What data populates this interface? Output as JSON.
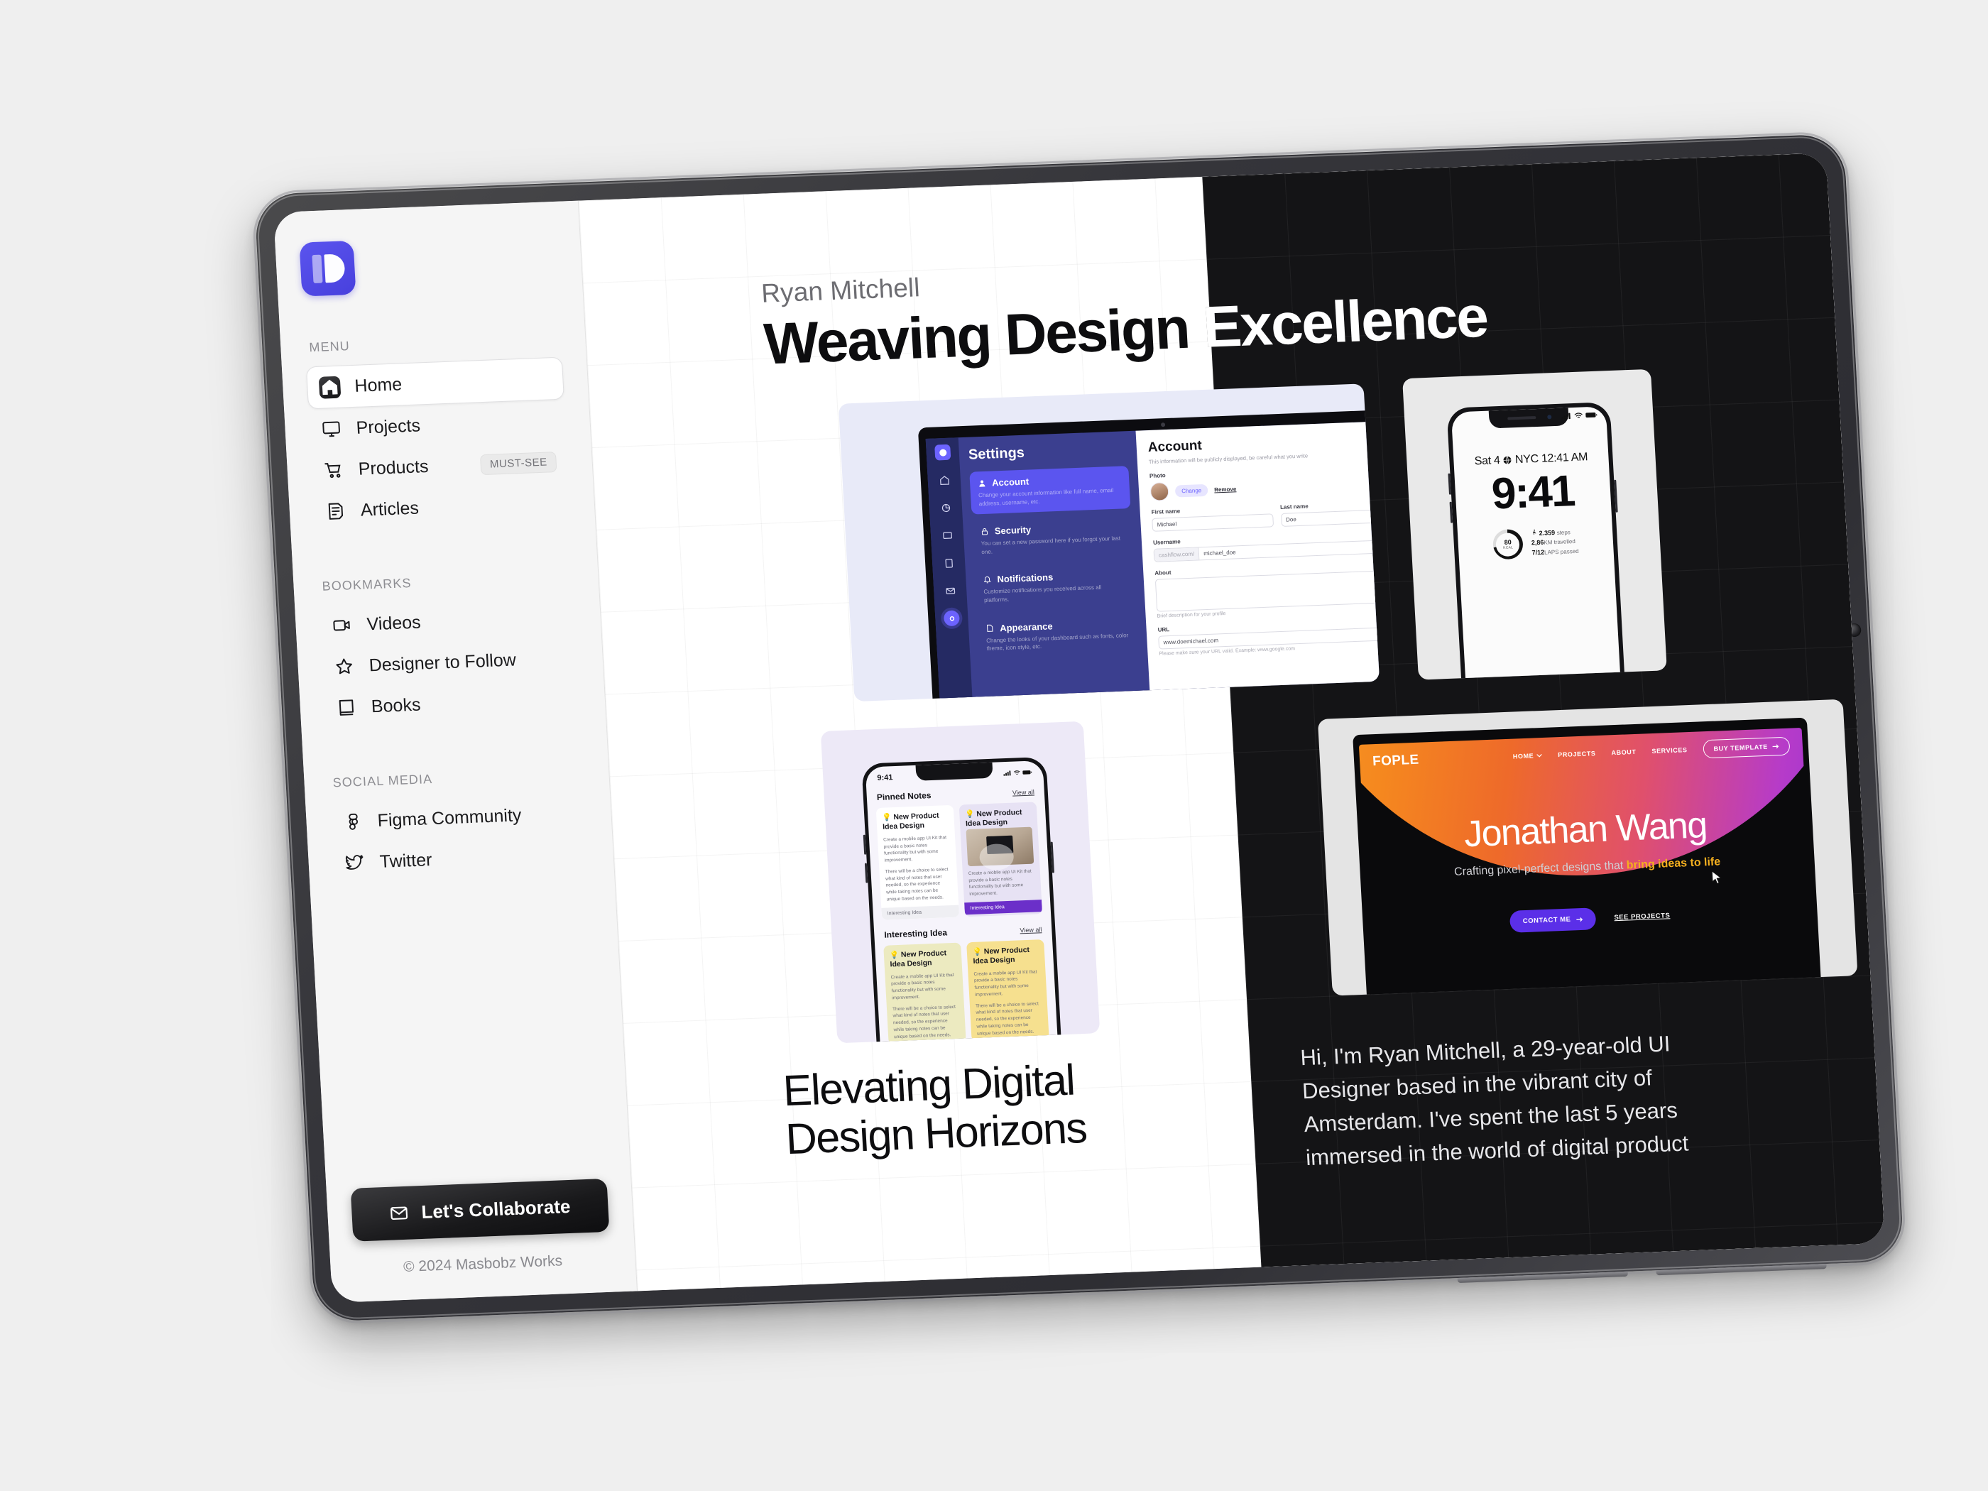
{
  "sidebar": {
    "logo_alt": "D",
    "menu_label": "MENU",
    "menu_items": [
      {
        "label": "Home",
        "icon": "home-icon",
        "active": true
      },
      {
        "label": "Projects",
        "icon": "monitor-icon",
        "active": false
      },
      {
        "label": "Products",
        "icon": "cart-icon",
        "active": false,
        "badge": "MUST-SEE"
      },
      {
        "label": "Articles",
        "icon": "article-icon",
        "active": false
      }
    ],
    "bookmarks_label": "BOOKMARKS",
    "bookmark_items": [
      {
        "label": "Videos",
        "icon": "video-icon"
      },
      {
        "label": "Designer to Follow",
        "icon": "star-icon"
      },
      {
        "label": "Books",
        "icon": "book-icon"
      }
    ],
    "social_label": "SOCIAL MEDIA",
    "social_items": [
      {
        "label": "Figma Community",
        "icon": "figma-icon"
      },
      {
        "label": "Twitter",
        "icon": "twitter-icon"
      }
    ],
    "collaborate_button": "Let's Collaborate",
    "copyright": "© 2024 Masbobz Works"
  },
  "hero": {
    "eyebrow": "Ryan Mitchell",
    "headline": "Weaving Design Excellence"
  },
  "footer": {
    "heading_line1": "Elevating Digital",
    "heading_line2": "Design Horizons",
    "bio": "Hi, I'm Ryan Mitchell, a 29-year-old UI Designer based in the vibrant city of Amsterdam. I've spent the last 5 years immersed in the world of digital product"
  },
  "cards": {
    "settings": {
      "nav_title": "Settings",
      "menu": [
        {
          "name": "Account",
          "sub": "Change your account information like full name, email address, username, etc.",
          "active": true
        },
        {
          "name": "Security",
          "sub": "You can set a new password here if you forgot your last one.",
          "active": false
        },
        {
          "name": "Notifications",
          "sub": "Customize notifications you received across all platforms.",
          "active": false
        },
        {
          "name": "Appearance",
          "sub": "Change the looks of your dashboard such as fonts, color theme, icon style, etc.",
          "active": false
        }
      ],
      "panel_title": "Account",
      "panel_sub": "This information will be publicly displayed, be careful what you write",
      "photo_label": "Photo",
      "photo_change": "Change",
      "photo_remove": "Remove",
      "first_name_label": "First name",
      "first_name_value": "Michael",
      "last_name_label": "Last name",
      "last_name_value": "Doe",
      "username_label": "Username",
      "username_prefix": "cashflow.com/",
      "username_value": "michael_doe",
      "about_label": "About",
      "about_hint": "Brief description for your profile",
      "url_label": "URL",
      "url_value": "www.doemichael.com",
      "url_hint": "Please make sure your URL valid. Example: www.google.com"
    },
    "lockscreen": {
      "date": "Sat 4",
      "location": "NYC 12:41 AM",
      "time": "9:41",
      "calories_value": "80",
      "calories_unit": "KCAL",
      "steps_value": "2.359",
      "steps_unit": "steps",
      "distance_value": "2,86",
      "distance_unit": "KM travelled",
      "laps_value": "7/12",
      "laps_unit": "LAPS passed"
    },
    "notes": {
      "status_time": "9:41",
      "section1_title": "Pinned Notes",
      "section1_link": "View all",
      "section2_title": "Interesting Idea",
      "section2_link": "View all",
      "note_title": "New Product Idea Design",
      "note_body1": "Create a mobile app UI Kit that provide a basic notes functionality but with some improvement.",
      "note_body2": "There will be a choice to select what kind of notes that user needed, so the experience while taking notes can be unique based on the needs.",
      "note_tag": "Interesting Idea"
    },
    "fople": {
      "logo": "FOPLE",
      "nav": [
        "HOME",
        "PROJECTS",
        "ABOUT",
        "SERVICES"
      ],
      "cta": "BUY TEMPLATE",
      "name": "Jonathan Wang",
      "tagline_plain": "Crafting pixel-perfect designs that ",
      "tagline_accent": "bring ideas to life",
      "button_primary": "CONTACT ME",
      "button_secondary": "SEE PROJECTS"
    }
  },
  "colors": {
    "brand_purple": "#4840dd",
    "dark_panel": "#141416",
    "accent_orange": "#f5871f",
    "accent_violet": "#5b2fe8"
  }
}
